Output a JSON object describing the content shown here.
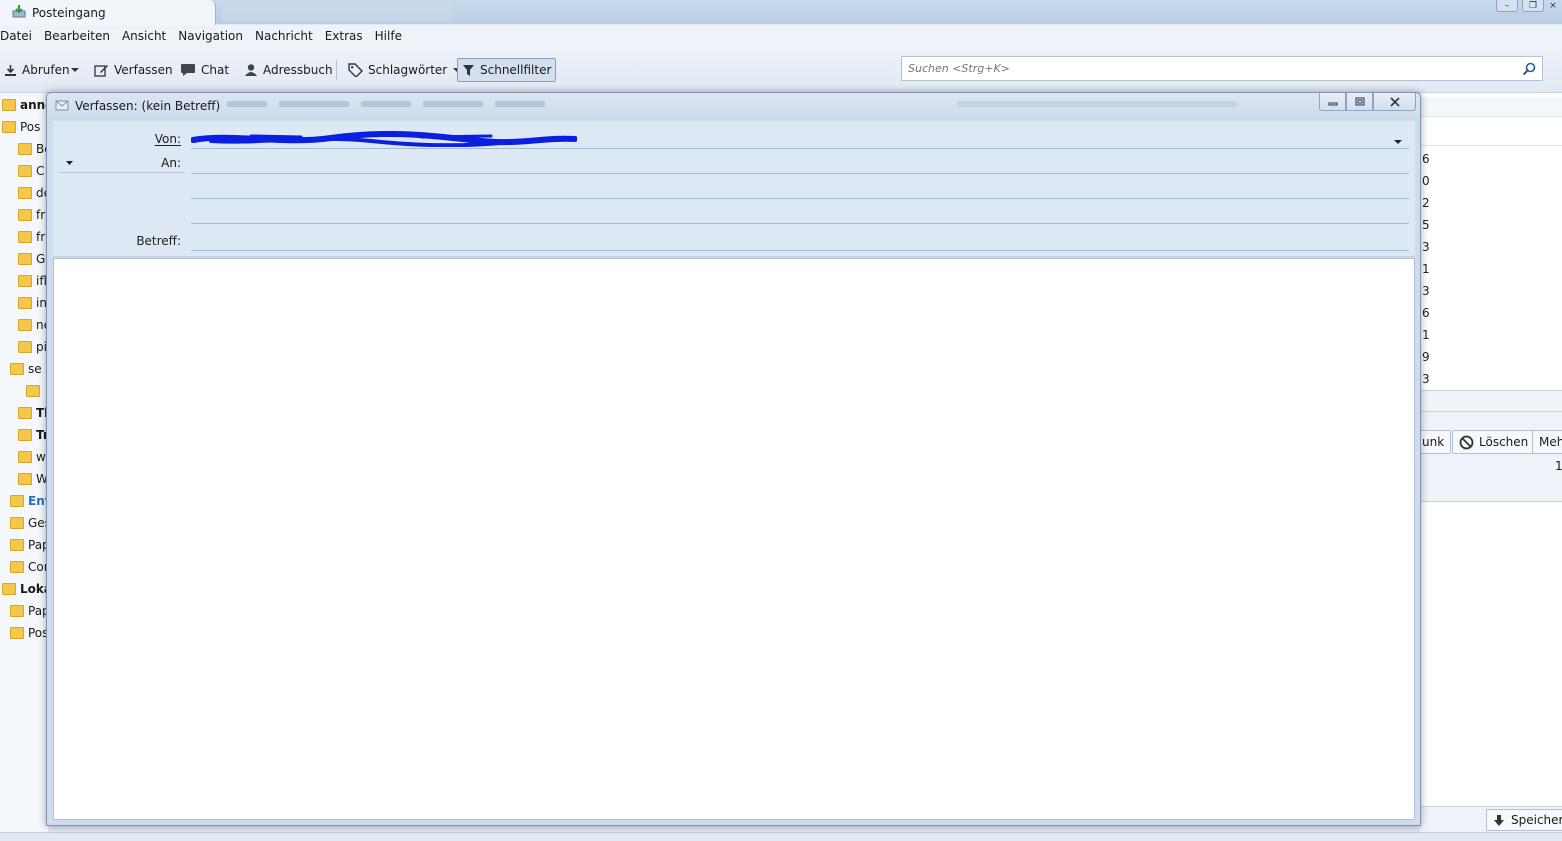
{
  "app": {
    "tab_title": "Posteingang"
  },
  "menu": [
    {
      "label": "Datei"
    },
    {
      "label": "Bearbeiten"
    },
    {
      "label": "Ansicht"
    },
    {
      "label": "Navigation"
    },
    {
      "label": "Nachricht"
    },
    {
      "label": "Extras"
    },
    {
      "label": "Hilfe"
    }
  ],
  "toolbar": {
    "abrufen": "Abrufen",
    "verfassen": "Verfassen",
    "chat": "Chat",
    "adressbuch": "Adressbuch",
    "schlagwoerter": "Schlagwörter",
    "schnellfilter": "Schnellfilter"
  },
  "search": {
    "placeholder": "Suchen <Strg+K>"
  },
  "folders": [
    {
      "label": "anne",
      "bold": true
    },
    {
      "label": "Pos"
    },
    {
      "label": "Be"
    },
    {
      "label": "C"
    },
    {
      "label": "de"
    },
    {
      "label": "fr"
    },
    {
      "label": "fr"
    },
    {
      "label": "Gl"
    },
    {
      "label": "ifl"
    },
    {
      "label": "in"
    },
    {
      "label": "ne"
    },
    {
      "label": "pi"
    },
    {
      "label": "se"
    },
    {
      "label": ""
    },
    {
      "label": "Th",
      "bold": true
    },
    {
      "label": "Tr",
      "bold": true
    },
    {
      "label": "w"
    },
    {
      "label": "W"
    },
    {
      "label": "Ent",
      "bold": true,
      "accent": true
    },
    {
      "label": "Ges"
    },
    {
      "label": "Pap"
    },
    {
      "label": "Cor"
    },
    {
      "label": "Loka",
      "bold": true
    },
    {
      "label": "Pap"
    },
    {
      "label": "Pos"
    }
  ],
  "message_counts": [
    "6",
    "0",
    "2",
    "5",
    "3",
    "1",
    "3",
    "6",
    "1",
    "9",
    "3"
  ],
  "header_pane": {
    "junk_label": "unk",
    "delete_label": "Löschen",
    "more_label": "Meh",
    "count": "1",
    "save_label": "Speichern"
  },
  "compose": {
    "window_title": "Verfassen: (kein Betreff)",
    "from_label": "Von:",
    "to_label": "An:",
    "subject_label": "Betreff:",
    "to_value": "",
    "subject_value": "",
    "body_value": ""
  },
  "colors": {
    "redaction": "#0a1fe0",
    "accent_link": "#2a6fc0",
    "folder": "#f5c84a"
  }
}
